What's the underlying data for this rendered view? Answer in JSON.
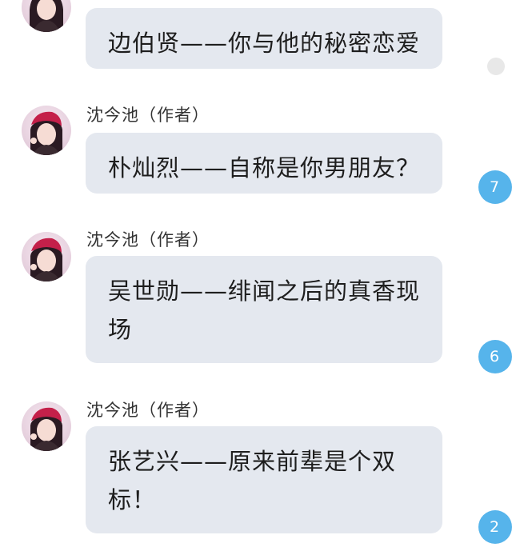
{
  "comments": [
    {
      "author": "",
      "text": "边伯贤——你与他的秘密恋爱",
      "reply_count": ""
    },
    {
      "author": "沈今池（作者）",
      "text": "朴灿烈——自称是你男朋友？",
      "reply_count": "7"
    },
    {
      "author": "沈今池（作者）",
      "text": "吴世勋——绯闻之后的真香现场",
      "reply_count": "6"
    },
    {
      "author": "沈今池（作者）",
      "text": "张艺兴——原来前辈是个双标！",
      "reply_count": "2"
    }
  ],
  "colors": {
    "bubble": "#e4e8ef",
    "badge": "#56b4eb",
    "text": "#1e1e1e",
    "author": "#333333"
  }
}
